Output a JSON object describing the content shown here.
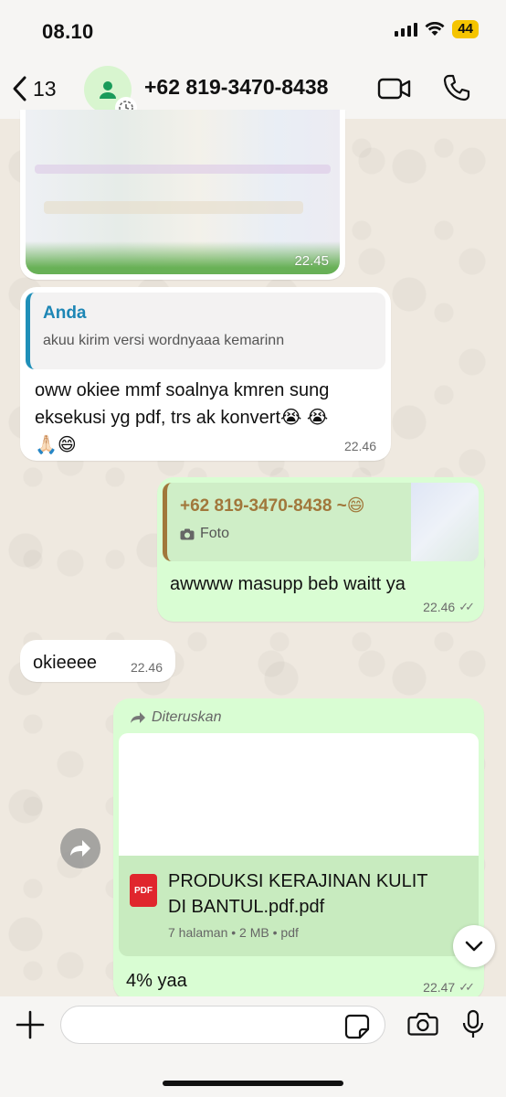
{
  "status_bar": {
    "time": "08.10",
    "battery": "44"
  },
  "header": {
    "back_count": "13",
    "contact_name": "+62 819-3470-8438"
  },
  "messages": {
    "image_time": "22.45",
    "reply": {
      "quote_author": "Anda",
      "quote_text": "akuu kirim versi wordnyaaa kemarinn",
      "text_line1": "oww okiee mmf soalnya kmren sung",
      "text_line2": "eksekusi yg pdf, trs ak konvert😭 😭",
      "text_line3": "🙏🏻😄",
      "time": "22.46"
    },
    "out_reply": {
      "quote_name": "+62 819-3470-8438 ~😄",
      "quote_sub": "Foto",
      "text": "awwww masupp beb waitt ya",
      "time": "22.46",
      "ticks": "✓✓"
    },
    "short_in": {
      "text": "okieeee",
      "time": "22.46"
    },
    "forwarded": {
      "label": "Diteruskan",
      "doc_name_line1": "PRODUKSI KERAJINAN KULIT",
      "doc_name_line2": "DI BANTUL.pdf.pdf",
      "pdf_badge": "PDF",
      "doc_meta": "7 halaman • 2 MB • pdf",
      "caption": "4% yaa",
      "time": "22.47",
      "ticks": "✓✓"
    }
  },
  "input": {
    "placeholder": "",
    "value": ""
  },
  "colors": {
    "outgoing": "#d9fdd3",
    "incoming": "#ffffff",
    "accent": "#1d86b5"
  }
}
